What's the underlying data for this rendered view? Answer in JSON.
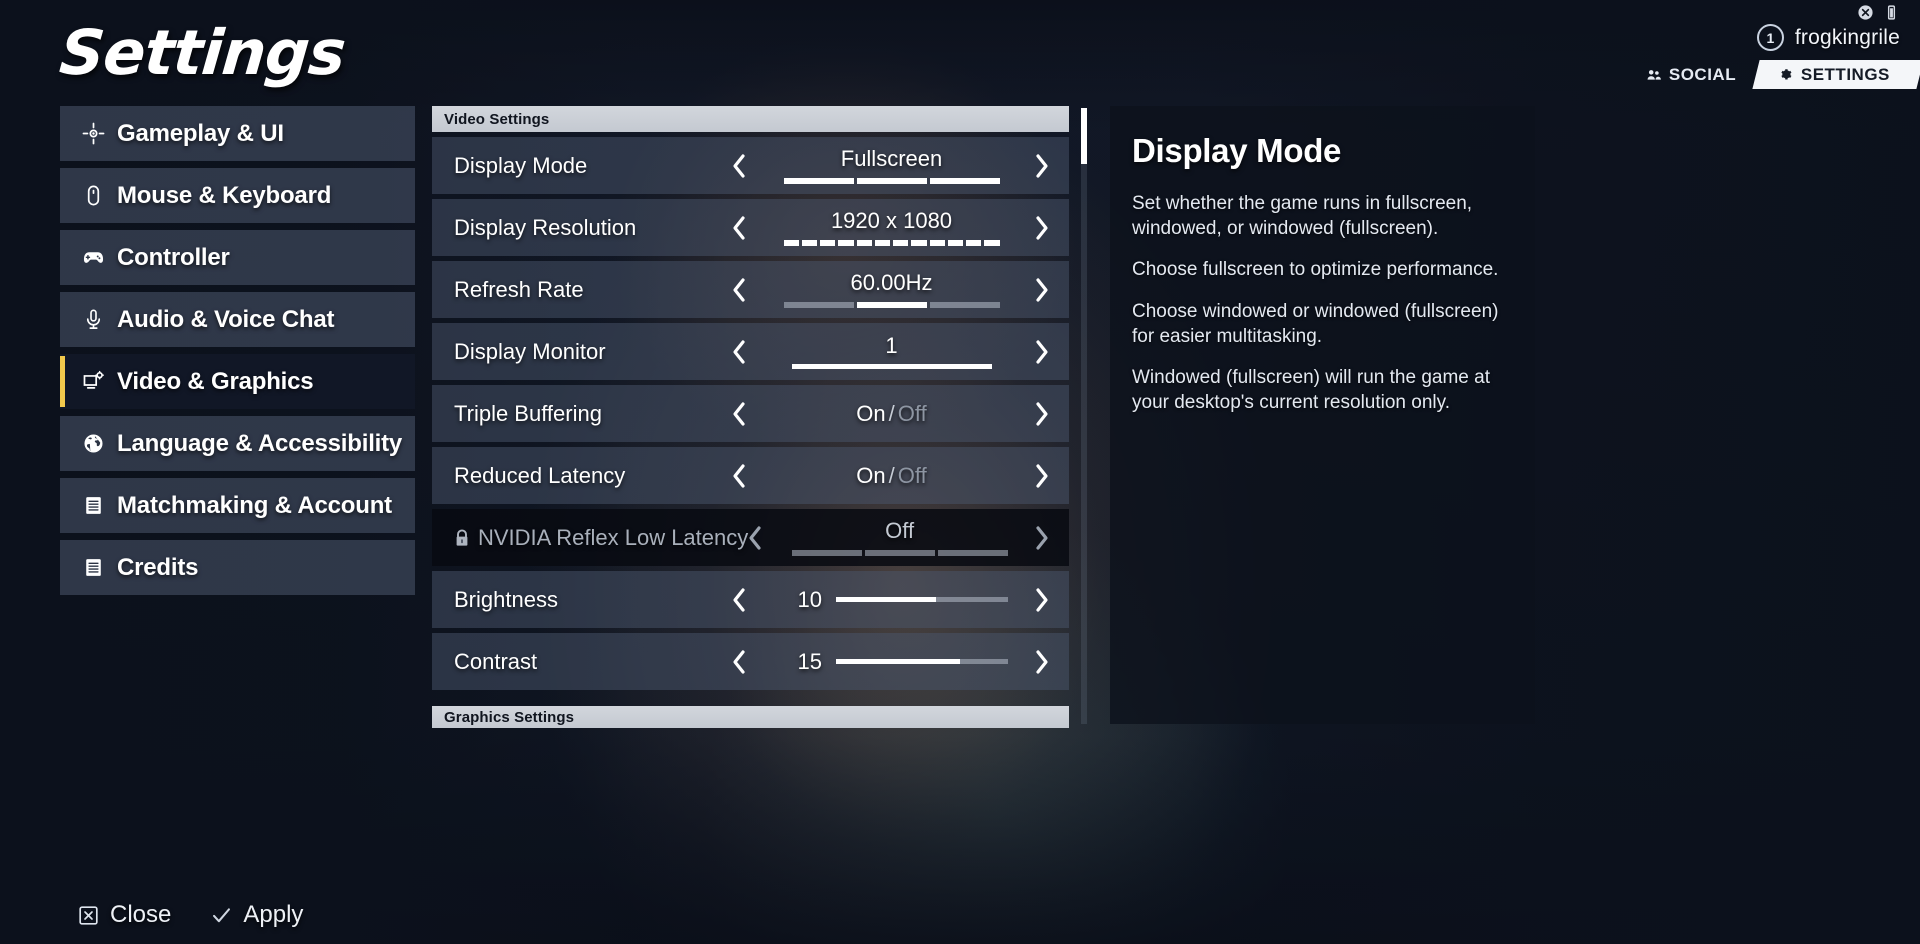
{
  "header": {
    "title": "Settings",
    "account_number": "1",
    "account_name": "frogkingrile",
    "tabs": [
      {
        "label": "SOCIAL",
        "icon": "people-icon",
        "active": false
      },
      {
        "label": "SETTINGS",
        "icon": "gear-icon",
        "active": true
      }
    ],
    "system_icons": [
      "close-circle-icon",
      "battery-icon"
    ]
  },
  "sidebar": {
    "items": [
      {
        "label": "Gameplay & UI",
        "icon": "crosshair-icon",
        "selected": false
      },
      {
        "label": "Mouse & Keyboard",
        "icon": "mouse-icon",
        "selected": false
      },
      {
        "label": "Controller",
        "icon": "gamepad-icon",
        "selected": false
      },
      {
        "label": "Audio & Voice Chat",
        "icon": "microphone-icon",
        "selected": false
      },
      {
        "label": "Video & Graphics",
        "icon": "monitor-gear-icon",
        "selected": true
      },
      {
        "label": "Language & Accessibility",
        "icon": "globe-icon",
        "selected": false
      },
      {
        "label": "Matchmaking & Account",
        "icon": "list-icon",
        "selected": false
      },
      {
        "label": "Credits",
        "icon": "list-icon",
        "selected": false
      }
    ],
    "accent_color": "#f2c94c"
  },
  "settings": {
    "section_title": "Video Settings",
    "next_section_title": "Graphics Settings",
    "rows": [
      {
        "label": "Display Mode",
        "value": "Fullscreen",
        "control": "segments",
        "segments_total": 3,
        "segments_active": 3,
        "locked": false,
        "selected": true
      },
      {
        "label": "Display Resolution",
        "value": "1920 x 1080",
        "control": "dots",
        "segments_total": 12,
        "segments_active": 12,
        "locked": false,
        "selected": false
      },
      {
        "label": "Refresh Rate",
        "value": "60.00Hz",
        "control": "segments",
        "segments_total": 3,
        "segments_active": 2,
        "locked": false,
        "selected": false
      },
      {
        "label": "Display Monitor",
        "value": "1",
        "control": "fullbar",
        "locked": false,
        "selected": false
      },
      {
        "label": "Triple Buffering",
        "value_on": "On",
        "value_separator": "/",
        "value_off": "Off",
        "control": "toggle",
        "state": "On",
        "locked": false,
        "selected": false
      },
      {
        "label": "Reduced Latency",
        "value_on": "On",
        "value_separator": "/",
        "value_off": "Off",
        "control": "toggle",
        "state": "On",
        "locked": false,
        "selected": false
      },
      {
        "label": "NVIDIA Reflex Low Latency",
        "value": "Off",
        "control": "segments",
        "segments_total": 3,
        "segments_active": 0,
        "locked": true,
        "lock_icon": "lock-icon",
        "selected": false
      },
      {
        "label": "Brightness",
        "value": "10",
        "control": "slider",
        "slider_percent": 58,
        "locked": false,
        "selected": false
      },
      {
        "label": "Contrast",
        "value": "15",
        "control": "slider",
        "slider_percent": 72,
        "locked": false,
        "selected": false
      }
    ]
  },
  "description": {
    "title": "Display Mode",
    "paragraphs": [
      "Set whether the game runs in fullscreen, windowed, or windowed (fullscreen).",
      "Choose fullscreen to optimize performance.",
      "Choose windowed or windowed (fullscreen) for easier multitasking.",
      "Windowed (fullscreen) will run the game at your desktop's current resolution only."
    ]
  },
  "actions": [
    {
      "label": "Close",
      "icon": "x-box-icon"
    },
    {
      "label": "Apply",
      "icon": "check-icon"
    }
  ]
}
